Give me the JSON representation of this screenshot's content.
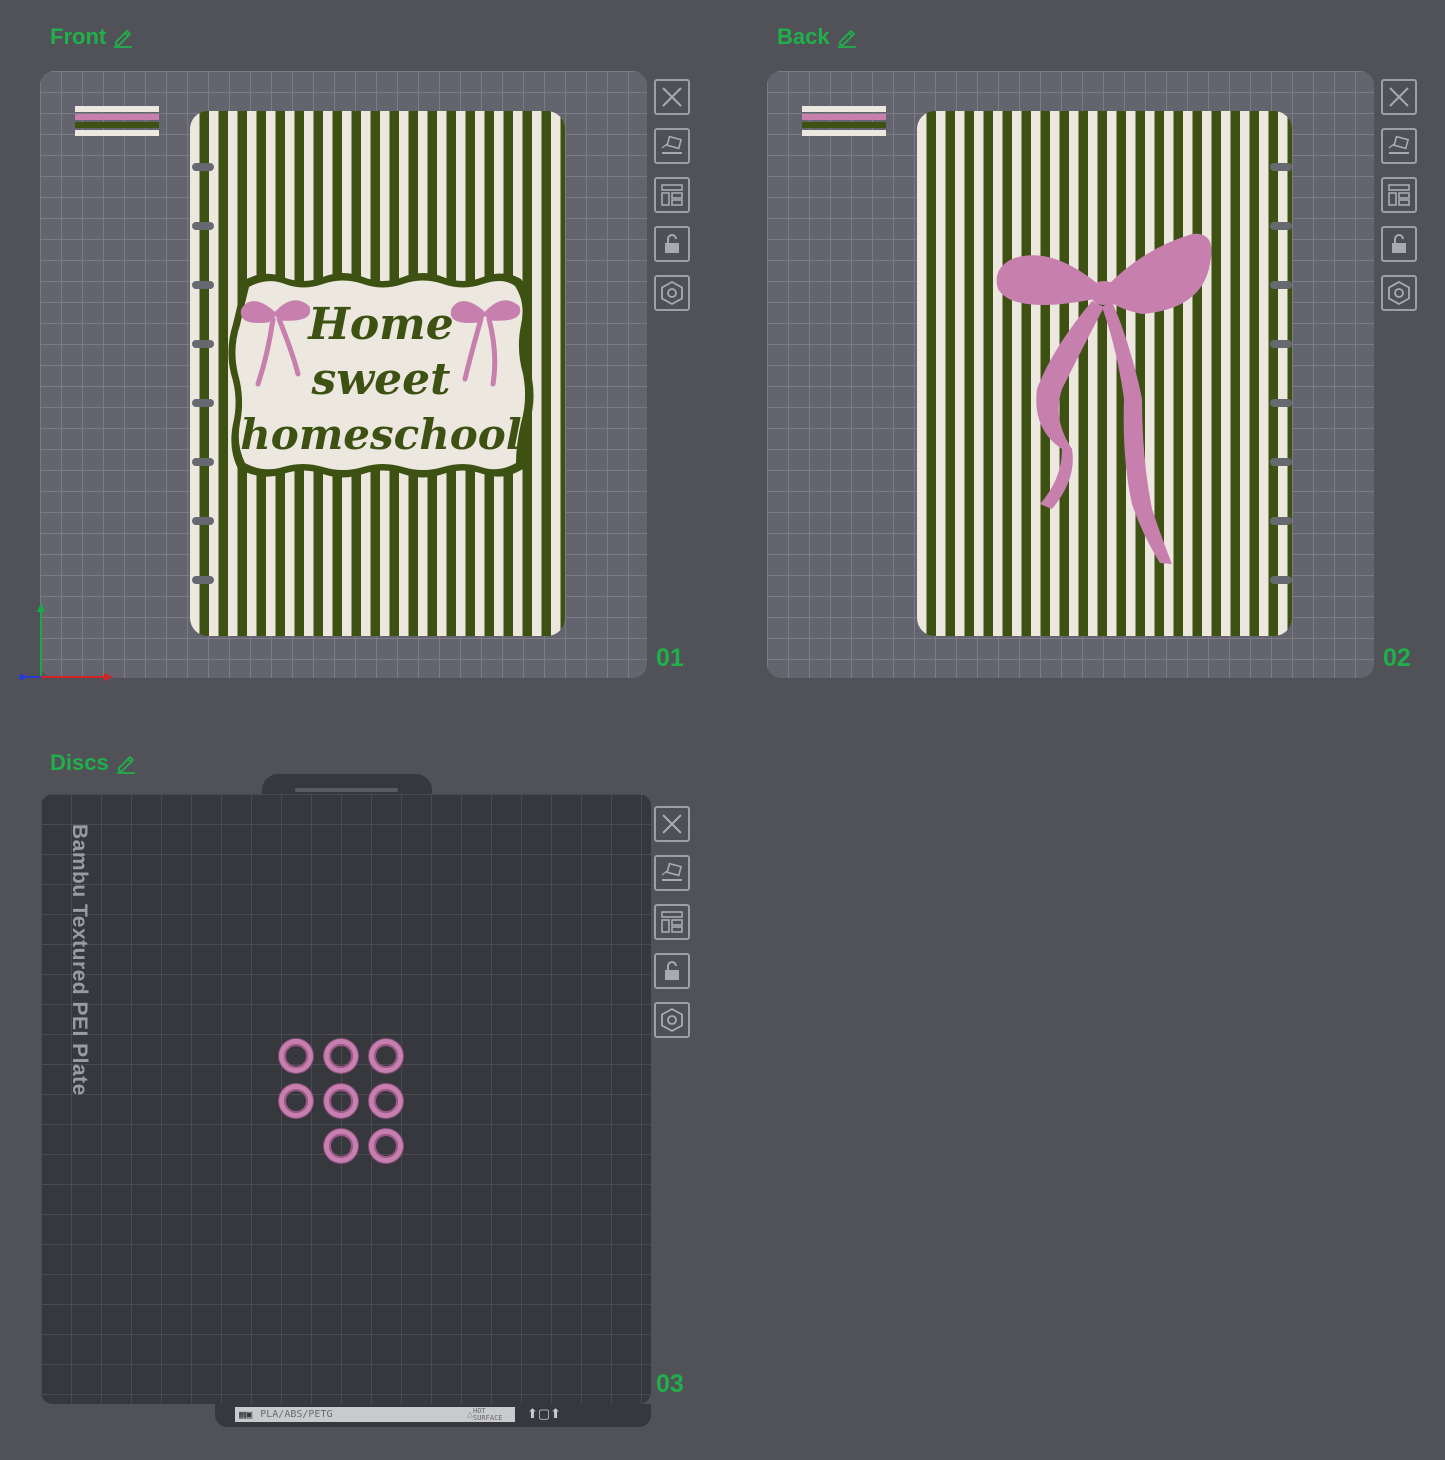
{
  "plates": [
    {
      "name": "Front",
      "number": "01"
    },
    {
      "name": "Back",
      "number": "02"
    },
    {
      "name": "Discs",
      "number": "03"
    }
  ],
  "front_cover": {
    "line1": "Home",
    "line2": "sweet",
    "line3": "homeschool"
  },
  "pei_plate": {
    "label": "Bambu Textured PEI Plate",
    "footer_material": "PLA/ABS/PETG",
    "footer_warning": "HOT SURFACE"
  },
  "tools": {
    "icons": [
      "close-icon",
      "auto-orient-icon",
      "arrange-icon",
      "lock-icon",
      "settings-icon"
    ]
  },
  "colors": {
    "accent": "#1fb04a",
    "stripe_green": "#3d5212",
    "stripe_cream": "#ece7df",
    "bow_pink": "#c77fae"
  }
}
